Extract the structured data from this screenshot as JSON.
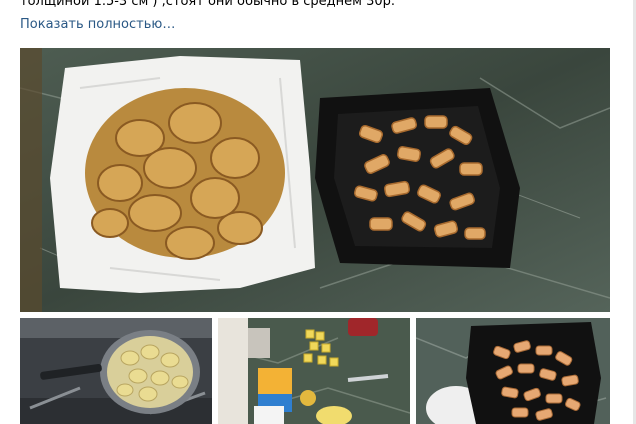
{
  "post": {
    "text_line": "толщиной 1.5-3 см ) ,стоят они обычно в среднем 30р.",
    "show_more_label": "Показать полностью…"
  },
  "photos": [
    {
      "description": "fried potato chips on paper towel and plate of fried pieces"
    },
    {
      "description": "frying pan with potato slices on stove"
    },
    {
      "description": "kitchen counter with cut potatoes and ingredients"
    },
    {
      "description": "black plate with fried pieces"
    }
  ]
}
